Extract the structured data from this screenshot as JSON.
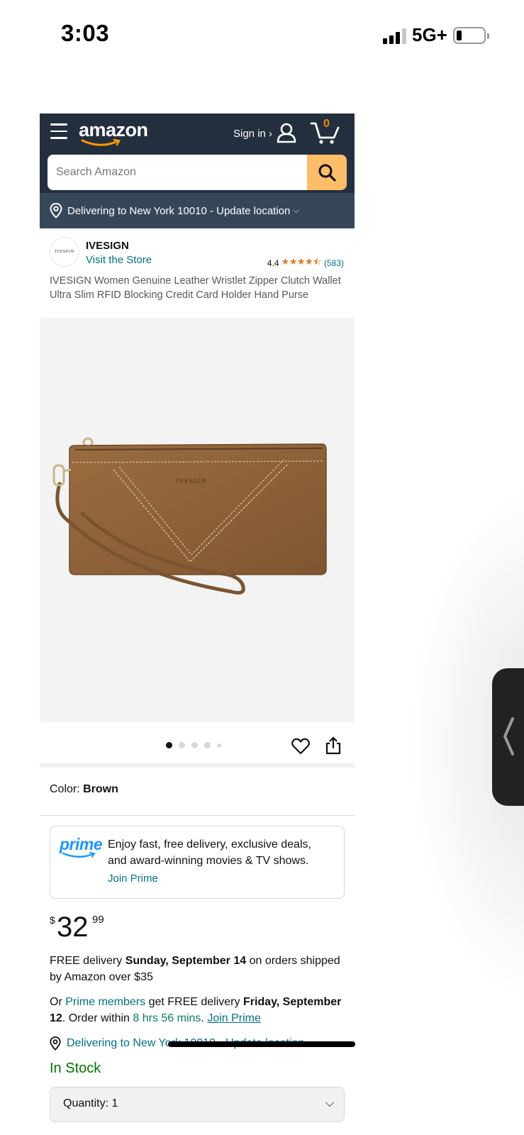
{
  "status_bar": {
    "time": "3:03",
    "network": "5G+"
  },
  "header": {
    "logo": "amazon",
    "signin": "Sign in ›",
    "cart_count": "0"
  },
  "search": {
    "placeholder": "Search Amazon"
  },
  "location_bar": {
    "text": "Delivering to New York 10010 - Update location",
    "chevron": "⌵"
  },
  "brand": {
    "logo_text": "IVESIGN",
    "name": "IVESIGN",
    "store_link": "Visit the Store",
    "rating": "4.4",
    "stars": "★★★★⯪",
    "rating_count": 583,
    "rating_count_text": "(583)"
  },
  "product": {
    "title": "IVESIGN Women Genuine Leather Wristlet Zipper Clutch Wallet Ultra Slim RFID Blocking Credit Card Holder Hand Purse",
    "image_brand_mark": "IVESIGN",
    "image_count": 5,
    "active_image": 1
  },
  "color": {
    "label": "Color: ",
    "value": "Brown"
  },
  "prime": {
    "logo": "prime",
    "text": "Enjoy fast, free delivery, exclusive deals, and award-winning movies & TV shows.",
    "join": "Join Prime"
  },
  "price": {
    "currency": "$",
    "whole": "32",
    "fraction": "99"
  },
  "delivery": {
    "line1_a": "FREE delivery ",
    "line1_b": "Sunday, September 14",
    "line1_c": " on orders shipped by Amazon over $35",
    "line2_a": "Or ",
    "line2_link": "Prime members",
    "line2_b": " get FREE delivery ",
    "line2_date": "Friday, September 12",
    "line2_c": ". Order within ",
    "line2_time": "8 hrs 56 mins",
    "line2_d": ". ",
    "line2_join": "Join Prime",
    "location": "Delivering to New York 10010 - Update location"
  },
  "stock": "In Stock",
  "quantity": {
    "label": "Quantity: 1",
    "chevron": "⌵"
  },
  "colors": {
    "header_bg": "#232f3e",
    "location_bg": "#37475a",
    "search_button": "#febd69",
    "link": "#007185",
    "star": "#de7921",
    "prime_blue": "#1a98ff",
    "in_stock": "#007600",
    "product_brown": "#8e6238"
  },
  "icons": [
    "menu-icon",
    "user-icon",
    "cart-icon",
    "search-icon",
    "location-pin-icon",
    "heart-icon",
    "share-icon",
    "chevron-left-icon"
  ]
}
